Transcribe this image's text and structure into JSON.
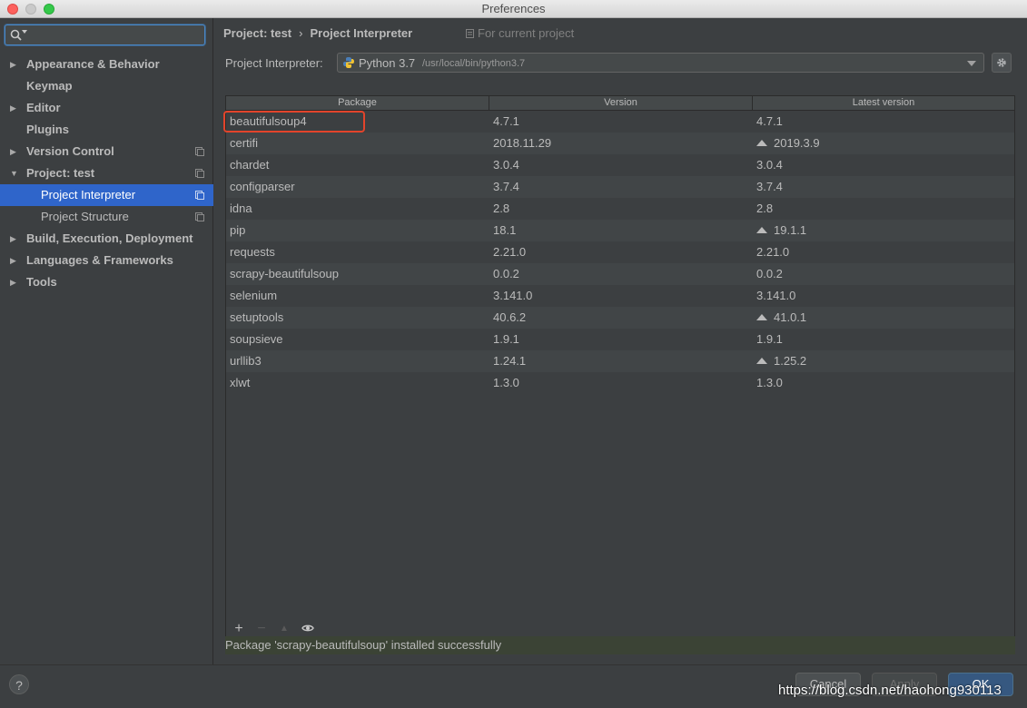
{
  "window": {
    "title": "Preferences"
  },
  "sidebar": {
    "search": {
      "value": "",
      "placeholder": ""
    },
    "items": [
      {
        "label": "Appearance & Behavior",
        "arrow": "▶"
      },
      {
        "label": "Keymap",
        "arrow": ""
      },
      {
        "label": "Editor",
        "arrow": "▶"
      },
      {
        "label": "Plugins",
        "arrow": ""
      },
      {
        "label": "Version Control",
        "arrow": "▶"
      },
      {
        "label": "Project: test",
        "arrow": "▼"
      },
      {
        "label": "Project Interpreter",
        "arrow": ""
      },
      {
        "label": "Project Structure",
        "arrow": ""
      },
      {
        "label": "Build, Execution, Deployment",
        "arrow": "▶"
      },
      {
        "label": "Languages & Frameworks",
        "arrow": "▶"
      },
      {
        "label": "Tools",
        "arrow": "▶"
      }
    ]
  },
  "main": {
    "breadcrumb": {
      "project": "Project: test",
      "separator": "›",
      "page": "Project Interpreter"
    },
    "for_current_project": "For current project",
    "interpreter": {
      "label": "Project Interpreter:",
      "name": "Python 3.7",
      "path": "/usr/local/bin/python3.7"
    },
    "table": {
      "headers": [
        "Package",
        "Version",
        "Latest version"
      ],
      "rows": [
        {
          "package": "beautifulsoup4",
          "version": "4.7.1",
          "latest": "4.7.1",
          "upgrade": false
        },
        {
          "package": "certifi",
          "version": "2018.11.29",
          "latest": "2019.3.9",
          "upgrade": true
        },
        {
          "package": "chardet",
          "version": "3.0.4",
          "latest": "3.0.4",
          "upgrade": false
        },
        {
          "package": "configparser",
          "version": "3.7.4",
          "latest": "3.7.4",
          "upgrade": false
        },
        {
          "package": "idna",
          "version": "2.8",
          "latest": "2.8",
          "upgrade": false
        },
        {
          "package": "pip",
          "version": "18.1",
          "latest": "19.1.1",
          "upgrade": true
        },
        {
          "package": "requests",
          "version": "2.21.0",
          "latest": "2.21.0",
          "upgrade": false
        },
        {
          "package": "scrapy-beautifulsoup",
          "version": "0.0.2",
          "latest": "0.0.2",
          "upgrade": false
        },
        {
          "package": "selenium",
          "version": "3.141.0",
          "latest": "3.141.0",
          "upgrade": false
        },
        {
          "package": "setuptools",
          "version": "40.6.2",
          "latest": "41.0.1",
          "upgrade": true
        },
        {
          "package": "soupsieve",
          "version": "1.9.1",
          "latest": "1.9.1",
          "upgrade": false
        },
        {
          "package": "urllib3",
          "version": "1.24.1",
          "latest": "1.25.2",
          "upgrade": true
        },
        {
          "package": "xlwt",
          "version": "1.3.0",
          "latest": "1.3.0",
          "upgrade": false
        }
      ]
    },
    "toolbar": {
      "add": "+",
      "remove": "−",
      "upgrade": "▲"
    },
    "status_message": "Package 'scrapy-beautifulsoup' installed successfully"
  },
  "footer": {
    "help": "?",
    "cancel": "Cancel",
    "apply": "Apply",
    "ok": "OK"
  },
  "watermark": "https://blog.csdn.net/haohong930113",
  "colors": {
    "selection": "#2f65ca",
    "highlight_box": "#e3442b",
    "ok_button": "#365880"
  }
}
